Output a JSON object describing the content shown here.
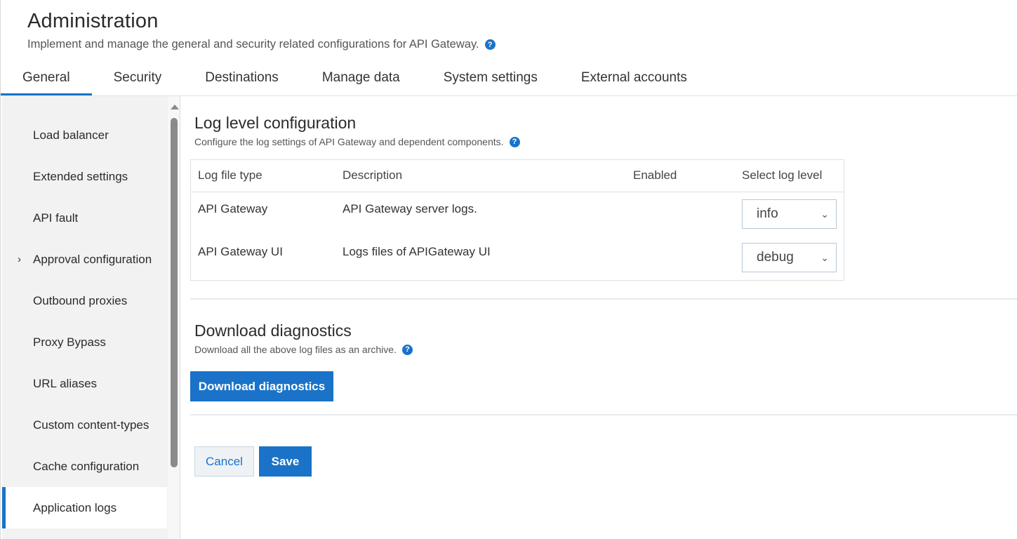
{
  "header": {
    "title": "Administration",
    "subtitle": "Implement and manage the general and security related configurations for API Gateway."
  },
  "tabs": [
    {
      "label": "General",
      "active": true
    },
    {
      "label": "Security"
    },
    {
      "label": "Destinations"
    },
    {
      "label": "Manage data"
    },
    {
      "label": "System settings"
    },
    {
      "label": "External accounts"
    }
  ],
  "sidebar": {
    "items": [
      {
        "label": "Load balancer"
      },
      {
        "label": "Extended settings"
      },
      {
        "label": "API fault"
      },
      {
        "label": "Approval configuration",
        "expandable": true
      },
      {
        "label": "Outbound proxies"
      },
      {
        "label": "Proxy Bypass"
      },
      {
        "label": "URL aliases"
      },
      {
        "label": "Custom content-types"
      },
      {
        "label": "Cache configuration"
      },
      {
        "label": "Application logs",
        "active": true
      }
    ]
  },
  "log_level": {
    "title": "Log level configuration",
    "subtitle": "Configure the log settings of API Gateway and dependent components.",
    "columns": [
      "Log file type",
      "Description",
      "Enabled",
      "Select log level"
    ],
    "rows": [
      {
        "type": "API Gateway",
        "description": "API Gateway server logs.",
        "enabled": "",
        "level": "info"
      },
      {
        "type": "API Gateway UI",
        "description": "Logs files of APIGateway UI",
        "enabled": "",
        "level": "debug"
      }
    ]
  },
  "diagnostics": {
    "title": "Download diagnostics",
    "subtitle": "Download all the above log files as an archive.",
    "button_label": "Download diagnostics"
  },
  "actions": {
    "cancel_label": "Cancel",
    "save_label": "Save"
  },
  "icons": {
    "help": "?",
    "chevron_right": "›",
    "chevron_down": "⌄"
  },
  "colors": {
    "accent": "#1a73c8"
  }
}
